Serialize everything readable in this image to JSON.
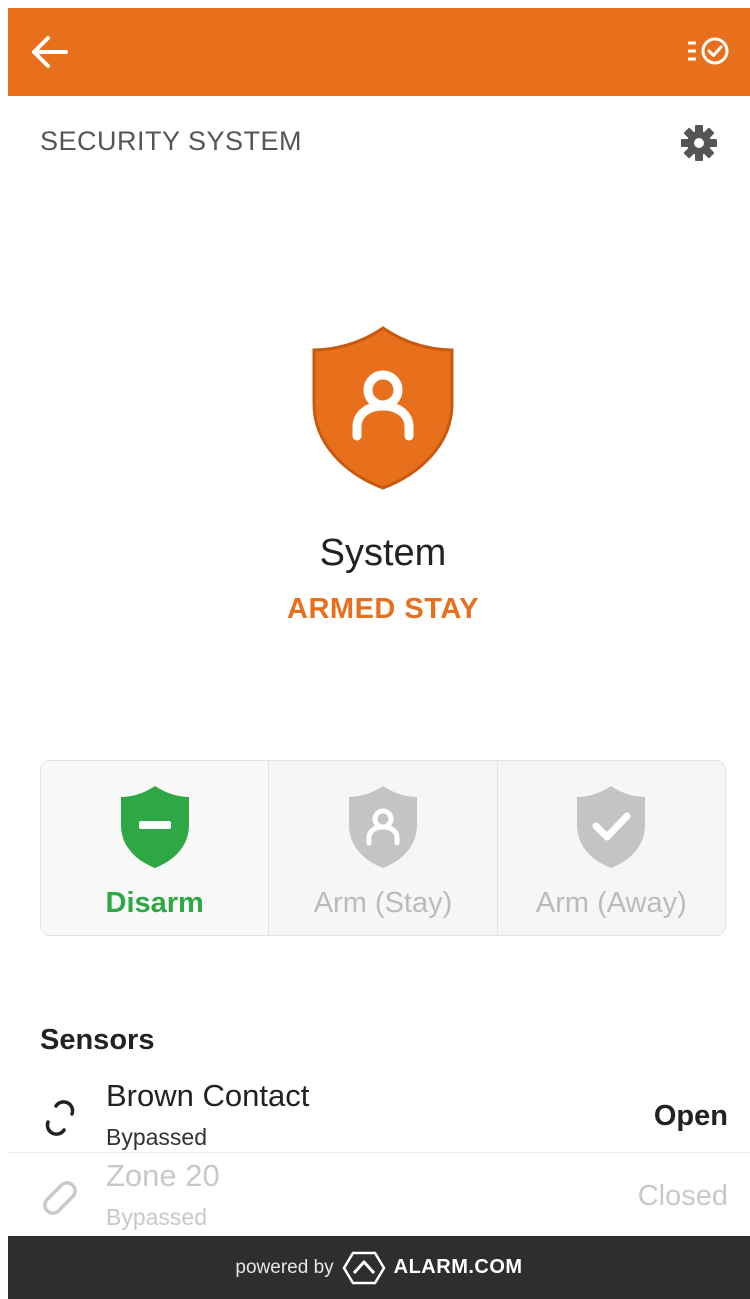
{
  "header": {
    "back_icon": "arrow-left-icon",
    "history_icon": "list-check-icon",
    "background_color": "#e8701d"
  },
  "section": {
    "title": "SECURITY SYSTEM",
    "settings_icon": "gear-icon"
  },
  "system": {
    "name": "System",
    "state": "ARMED STAY",
    "state_icon": "shield-person-icon",
    "state_color": "#e8701d"
  },
  "arm_options": [
    {
      "label": "Disarm",
      "icon": "shield-minus-icon",
      "active": true,
      "color": "#2ea844"
    },
    {
      "label": "Arm (Stay)",
      "icon": "shield-person-icon",
      "active": false,
      "color": "#bbbbbb"
    },
    {
      "label": "Arm (Away)",
      "icon": "shield-check-icon",
      "active": false,
      "color": "#bbbbbb"
    }
  ],
  "sensors": {
    "title": "Sensors",
    "items": [
      {
        "name": "Brown Contact",
        "sub": "Bypassed",
        "status": "Open",
        "icon": "broken-link-icon"
      },
      {
        "name": "Zone 20",
        "sub": "Bypassed",
        "status": "Closed",
        "icon": "link-icon"
      }
    ]
  },
  "footer": {
    "powered_by": "powered by",
    "brand": "ALARM.COM",
    "logo_icon": "alarm-com-logo-icon"
  }
}
